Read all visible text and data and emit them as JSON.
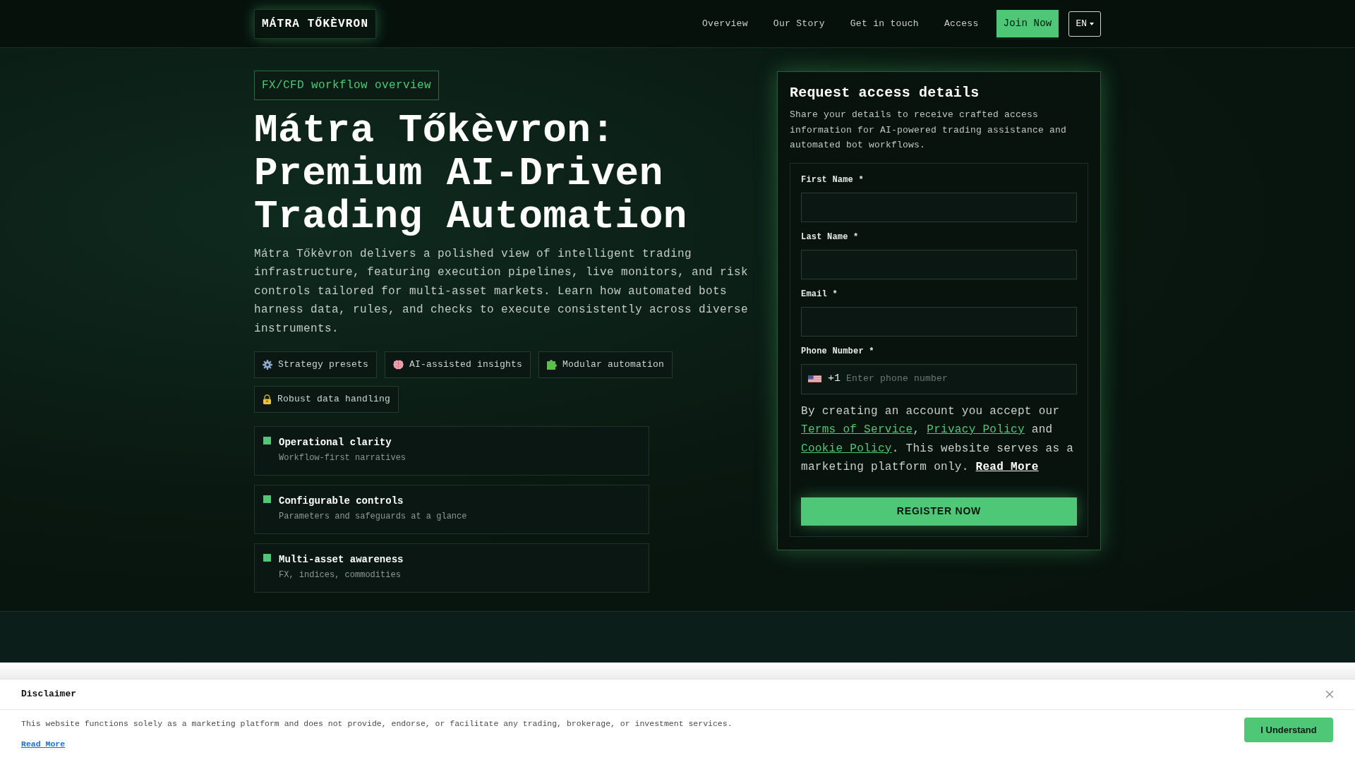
{
  "header": {
    "logo": "MÁTRA TŐKÈVRON",
    "nav": [
      {
        "label": "Overview"
      },
      {
        "label": "Our Story"
      },
      {
        "label": "Get in touch"
      },
      {
        "label": "Access"
      }
    ],
    "cta": "Join Now",
    "language": "EN"
  },
  "hero": {
    "badge": "FX/CFD workflow overview",
    "title": "Mátra Tőkèvron: Premium AI-Driven Trading Automation",
    "description": "Mátra Tőkèvron delivers a polished view of intelligent trading infrastructure, featuring execution pipelines, live monitors, and risk controls tailored for multi-asset markets. Learn how automated bots harness data, rules, and checks to execute consistently across diverse instruments.",
    "tags": [
      {
        "label": "Strategy presets"
      },
      {
        "label": "AI-assisted insights"
      },
      {
        "label": "Modular automation"
      },
      {
        "label": "Robust data handling"
      }
    ],
    "features": [
      {
        "title": "Operational clarity",
        "subtitle": "Workflow-first narratives"
      },
      {
        "title": "Configurable controls",
        "subtitle": "Parameters and safeguards at a glance"
      },
      {
        "title": "Multi-asset awareness",
        "subtitle": "FX, indices, commodities"
      }
    ]
  },
  "form": {
    "title": "Request access details",
    "description": "Share your details to receive crafted access information for AI-powered trading assistance and automated bot workflows.",
    "fields": [
      {
        "kind": "text",
        "label": "First Name *"
      },
      {
        "kind": "text",
        "label": "Last Name *"
      },
      {
        "kind": "text",
        "label": "Email *"
      },
      {
        "kind": "phone",
        "label": "Phone Number *",
        "dial_code": "+1",
        "placeholder": "Enter phone number"
      }
    ],
    "consent": [
      {
        "kind": "text",
        "text": "By creating an account you accept our "
      },
      {
        "kind": "link",
        "text": "Terms of Service"
      },
      {
        "kind": "text",
        "text": ", "
      },
      {
        "kind": "link",
        "text": "Privacy Policy"
      },
      {
        "kind": "text",
        "text": " and "
      },
      {
        "kind": "link",
        "text": "Cookie Policy"
      },
      {
        "kind": "text",
        "text": ". This website serves as a marketing platform only. "
      },
      {
        "kind": "strong_link",
        "text": "Read More"
      }
    ],
    "submit": "REGISTER NOW"
  },
  "disclaimer": {
    "title": "Disclaimer",
    "text": "This website functions solely as a marketing platform and does not provide, endorse, or facilitate any trading, brokerage, or investment services.",
    "link": "Read More",
    "button": "I Understand"
  }
}
